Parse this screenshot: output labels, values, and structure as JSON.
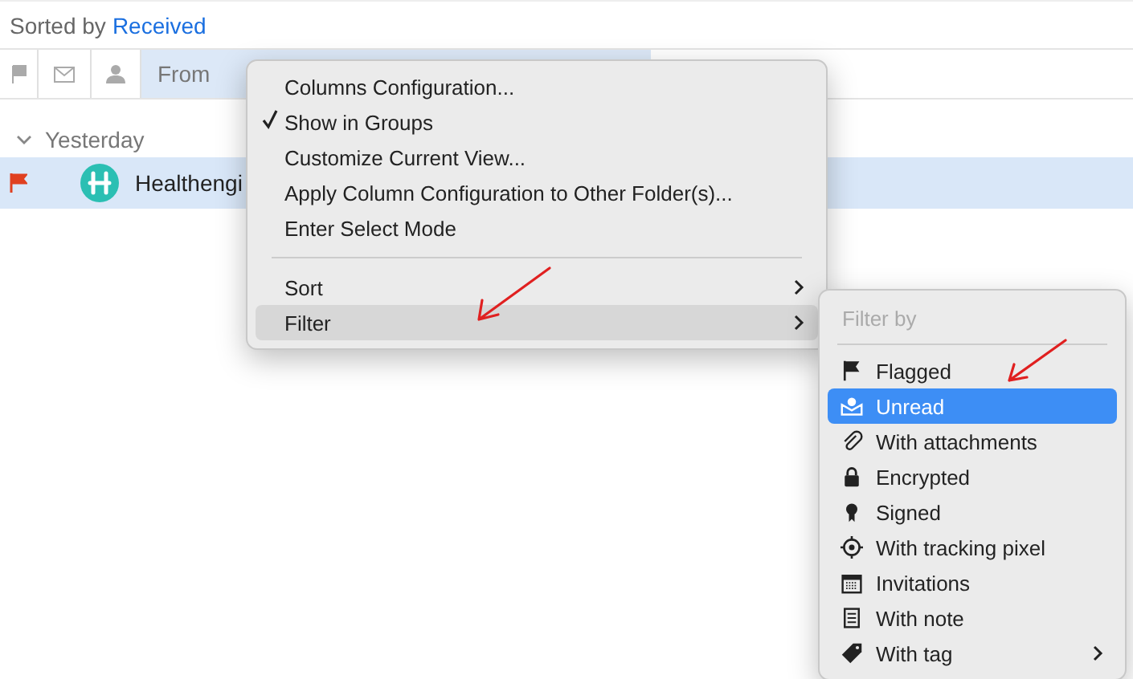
{
  "header": {
    "sorted_by_label": "Sorted by",
    "sorted_by_value": "Received"
  },
  "column_header": {
    "from_label": "From"
  },
  "groups": [
    {
      "label": "Yesterday",
      "expanded": true,
      "rows": [
        {
          "sender": "Healthengi",
          "flagged": true,
          "selected": true
        }
      ]
    }
  ],
  "context_menu": {
    "items": [
      {
        "kind": "item",
        "label": "Columns Configuration...",
        "checked": false,
        "has_submenu": false,
        "selected": false
      },
      {
        "kind": "item",
        "label": "Show in Groups",
        "checked": true,
        "has_submenu": false,
        "selected": false
      },
      {
        "kind": "item",
        "label": "Customize Current View...",
        "checked": false,
        "has_submenu": false,
        "selected": false
      },
      {
        "kind": "item",
        "label": "Apply Column Configuration to Other Folder(s)...",
        "checked": false,
        "has_submenu": false,
        "selected": false
      },
      {
        "kind": "item",
        "label": "Enter Select Mode",
        "checked": false,
        "has_submenu": false,
        "selected": false
      },
      {
        "kind": "separator"
      },
      {
        "kind": "item",
        "label": "Sort",
        "checked": false,
        "has_submenu": true,
        "selected": false
      },
      {
        "kind": "item",
        "label": "Filter",
        "checked": false,
        "has_submenu": true,
        "selected": true
      }
    ]
  },
  "filter_submenu": {
    "title": "Filter by",
    "items": [
      {
        "label": "Flagged",
        "selected": false,
        "has_submenu": false
      },
      {
        "label": "Unread",
        "selected": true,
        "has_submenu": false
      },
      {
        "label": "With attachments",
        "selected": false,
        "has_submenu": false
      },
      {
        "label": "Encrypted",
        "selected": false,
        "has_submenu": false
      },
      {
        "label": "Signed",
        "selected": false,
        "has_submenu": false
      },
      {
        "label": "With tracking pixel",
        "selected": false,
        "has_submenu": false
      },
      {
        "label": "Invitations",
        "selected": false,
        "has_submenu": false
      },
      {
        "label": "With note",
        "selected": false,
        "has_submenu": false
      },
      {
        "label": "With tag",
        "selected": false,
        "has_submenu": true
      }
    ]
  }
}
